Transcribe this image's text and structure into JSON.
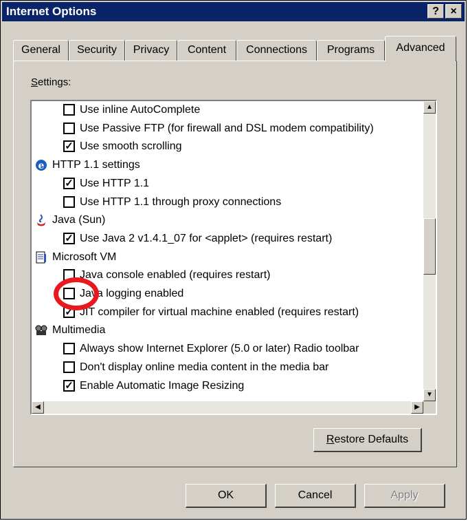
{
  "window": {
    "title": "Internet Options",
    "help_label": "?",
    "close_label": "×"
  },
  "tabs": [
    {
      "label": "General"
    },
    {
      "label": "Security"
    },
    {
      "label": "Privacy"
    },
    {
      "label": "Content"
    },
    {
      "label": "Connections"
    },
    {
      "label": "Programs"
    },
    {
      "label": "Advanced",
      "active": true
    }
  ],
  "settings_label_first": "S",
  "settings_label_rest": "ettings:",
  "settings_items": [
    {
      "type": "checkbox",
      "checked": false,
      "label": "Use inline AutoComplete"
    },
    {
      "type": "checkbox",
      "checked": false,
      "label": "Use Passive FTP (for firewall and DSL modem compatibility)"
    },
    {
      "type": "checkbox",
      "checked": true,
      "label": "Use smooth scrolling"
    },
    {
      "type": "category",
      "icon": "internet-explorer-icon",
      "label": "HTTP 1.1 settings"
    },
    {
      "type": "checkbox",
      "checked": true,
      "label": "Use HTTP 1.1"
    },
    {
      "type": "checkbox",
      "checked": false,
      "label": "Use HTTP 1.1 through proxy connections"
    },
    {
      "type": "category",
      "icon": "java-icon",
      "label": "Java (Sun)"
    },
    {
      "type": "checkbox",
      "checked": true,
      "label": "Use Java 2 v1.4.1_07 for <applet> (requires restart)"
    },
    {
      "type": "category",
      "icon": "document-icon",
      "label": "Microsoft VM"
    },
    {
      "type": "checkbox",
      "checked": false,
      "label": "Java console enabled (requires restart)"
    },
    {
      "type": "checkbox",
      "checked": false,
      "label": "Java logging enabled"
    },
    {
      "type": "checkbox",
      "checked": true,
      "label": "JIT compiler for virtual machine enabled (requires restart)"
    },
    {
      "type": "category",
      "icon": "multimedia-icon",
      "label": "Multimedia"
    },
    {
      "type": "checkbox",
      "checked": false,
      "label": "Always show Internet Explorer (5.0 or later) Radio toolbar"
    },
    {
      "type": "checkbox",
      "checked": false,
      "label": "Don't display online media content in the media bar"
    },
    {
      "type": "checkbox",
      "checked": true,
      "label": "Enable Automatic Image Resizing"
    }
  ],
  "restore_first": "R",
  "restore_rest": "estore Defaults",
  "buttons": {
    "ok": "OK",
    "cancel": "Cancel",
    "apply": "Apply"
  },
  "annotation": {
    "type": "red-circle",
    "highlights": "Java logging enabled"
  },
  "colors": {
    "titlebar": "#0a246a",
    "face": "#d4d0c8",
    "annotation": "#e8181f"
  }
}
